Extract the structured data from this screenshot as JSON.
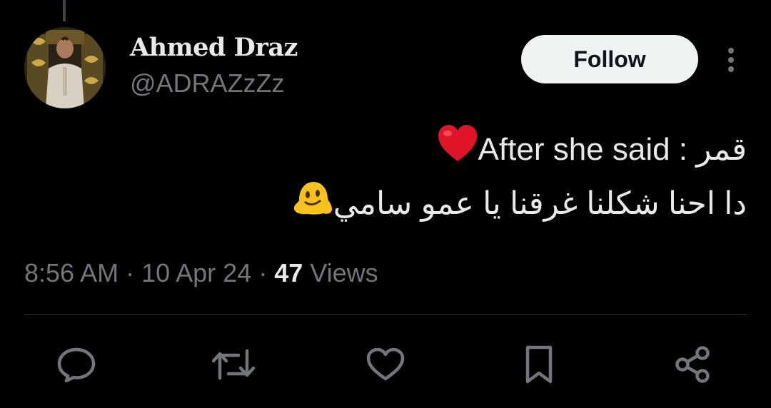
{
  "author": {
    "display_name": "Ahmed Draz",
    "handle": "@ADRAZzZz",
    "avatar_icon": "avatar"
  },
  "follow_label": "Follow",
  "more_icon": "more-vertical-icon",
  "tweet": {
    "line1": "After she said : قمر",
    "line1_emoji": "red-heart-emoji",
    "line2": "دا احنا شكلنا غرقنا يا عمو سامي",
    "line2_emoji": "melting-face-emoji"
  },
  "meta": {
    "time": "8:56 AM",
    "sep1": " · ",
    "date": "10 Apr 24",
    "sep2": " · ",
    "views_count": "47",
    "views_label": " Views"
  },
  "actions": [
    {
      "name": "reply",
      "icon": "reply-icon"
    },
    {
      "name": "repost",
      "icon": "repost-icon"
    },
    {
      "name": "like",
      "icon": "heart-icon"
    },
    {
      "name": "bookmark",
      "icon": "bookmark-icon"
    },
    {
      "name": "share",
      "icon": "share-icon"
    }
  ],
  "colors": {
    "background": "#000000",
    "primary_text": "#e7e9ea",
    "secondary_text": "#71767b",
    "divider": "#2f3336",
    "follow_bg": "#eff3f4",
    "follow_text": "#0f1419",
    "heart_red": "#e0152a",
    "emoji_yellow": "#f7c21c"
  }
}
